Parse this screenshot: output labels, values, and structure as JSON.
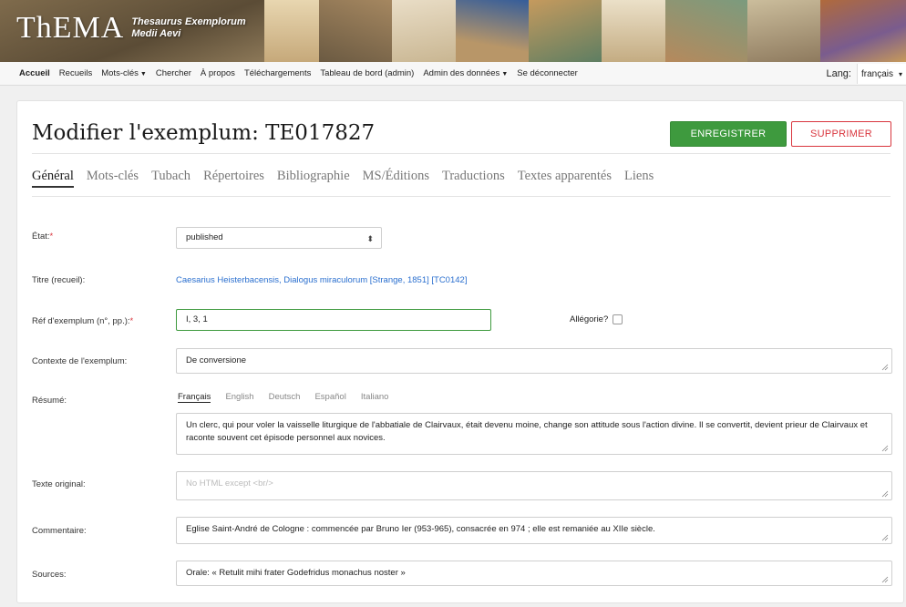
{
  "brand": {
    "logo": "ThEMA",
    "subtitle_line1": "Thesaurus Exemplorum",
    "subtitle_line2": "Medii Aevi"
  },
  "nav": {
    "items": [
      {
        "label": "Accueil",
        "active": true,
        "dropdown": false
      },
      {
        "label": "Recueils",
        "dropdown": false
      },
      {
        "label": "Mots-clés",
        "dropdown": true
      },
      {
        "label": "Chercher",
        "dropdown": false
      },
      {
        "label": "À propos",
        "dropdown": false
      },
      {
        "label": "Téléchargements",
        "dropdown": false
      },
      {
        "label": "Tableau de bord (admin)",
        "dropdown": false
      },
      {
        "label": "Admin des données",
        "dropdown": true
      },
      {
        "label": "Se déconnecter",
        "dropdown": false
      }
    ],
    "lang_label": "Lang:",
    "lang_value": "français"
  },
  "page": {
    "title": "Modifier l'exemplum: TE017827",
    "save_label": "ENREGISTRER",
    "delete_label": "SUPPRIMER",
    "save_color": "#3e9a3e",
    "delete_color": "#d9363e"
  },
  "tabs": [
    {
      "label": "Général",
      "active": true
    },
    {
      "label": "Mots-clés"
    },
    {
      "label": "Tubach"
    },
    {
      "label": "Répertoires"
    },
    {
      "label": "Bibliographie"
    },
    {
      "label": "MS/Éditions"
    },
    {
      "label": "Traductions"
    },
    {
      "label": "Textes apparentés"
    },
    {
      "label": "Liens"
    }
  ],
  "form": {
    "etat_label": "État:",
    "etat_value": "published",
    "titre_label": "Titre (recueil):",
    "titre_value": "Caesarius Heisterbacensis, Dialogus miraculorum [Strange, 1851] [TC0142]",
    "ref_label": "Réf d'exemplum (n°, pp.):",
    "ref_value": "I, 3, 1",
    "allegorie_label": "Allégorie?",
    "contexte_label": "Contexte de l'exemplum:",
    "contexte_value": "De conversione",
    "resume_label": "Résumé:",
    "resume_langs": [
      "Français",
      "English",
      "Deutsch",
      "Español",
      "Italiano"
    ],
    "resume_value": "Un clerc, qui pour voler la vaisselle liturgique de l'abbatiale de Clairvaux,  était devenu moine, change son attitude sous l'action divine. Il se convertit, devient prieur de Clairvaux et raconte souvent cet épisode personnel aux novices.",
    "texte_label": "Texte original:",
    "texte_placeholder": "No HTML except <br/>",
    "commentaire_label": "Commentaire:",
    "commentaire_value": "Eglise Saint-André de Cologne : commencée par Bruno Ier (953-965), consacrée en 974 ; elle est remaniée au XIIe siècle.",
    "sources_label": "Sources:",
    "sources_value": "Orale: « Retulit mihi frater Godefridus monachus noster »"
  }
}
